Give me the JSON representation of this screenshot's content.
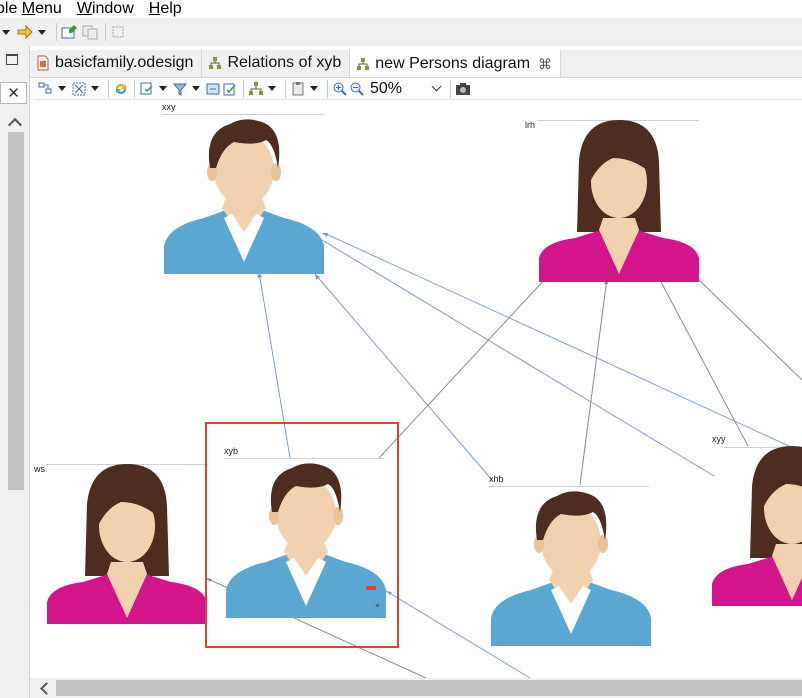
{
  "menu": {
    "item0": "ole Menu",
    "window": "Window",
    "help": "Help"
  },
  "tabs": [
    {
      "label": "basicfamily.odesign",
      "icon": "odesign-file-icon"
    },
    {
      "label": "Relations of xyb",
      "icon": "diagram-icon"
    },
    {
      "label": "new Persons diagram",
      "icon": "diagram-icon",
      "active": true,
      "close": "⌘"
    }
  ],
  "left_close": "✕",
  "zoom": {
    "value": "50%"
  },
  "nodes": [
    {
      "id": "xxy",
      "label": "xxy",
      "gender": "male"
    },
    {
      "id": "lrh",
      "label": "lrh",
      "gender": "female"
    },
    {
      "id": "ws",
      "label": "ws",
      "gender": "female"
    },
    {
      "id": "xyb",
      "label": "xyb",
      "gender": "male",
      "selected": true
    },
    {
      "id": "xhb",
      "label": "xhb",
      "gender": "male"
    },
    {
      "id": "xyy",
      "label": "xyy",
      "gender": "female"
    }
  ],
  "colors": {
    "male_shirt": "#5aa7d2",
    "female_shirt": "#d4148a",
    "hair": "#4e2c1f",
    "skin": "#f2d2ae",
    "edge_blue": "#7a9fd0",
    "edge_gray": "#8a8a8a",
    "selection": "#e0403a"
  }
}
